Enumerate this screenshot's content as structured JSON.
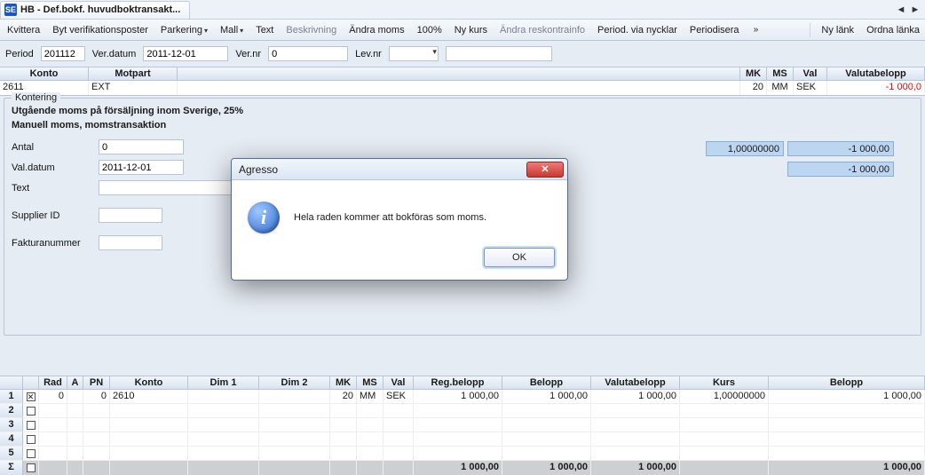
{
  "window": {
    "title": "HB - Def.bokf. huvudboktransakt...",
    "app_icon_text": "SE"
  },
  "toolbar": {
    "items": [
      {
        "label": "Kvittera",
        "disabled": false
      },
      {
        "label": "Byt verifikationsposter",
        "disabled": false
      },
      {
        "label": "Parkering",
        "disabled": false,
        "dropdown": true
      },
      {
        "label": "Mall",
        "disabled": false,
        "dropdown": true
      },
      {
        "label": "Text",
        "disabled": false
      },
      {
        "label": "Beskrivning",
        "disabled": true
      },
      {
        "label": "Ändra moms",
        "disabled": false
      },
      {
        "label": "100%",
        "disabled": false
      },
      {
        "label": "Ny kurs",
        "disabled": false
      },
      {
        "label": "Ändra reskontrainfo",
        "disabled": true
      },
      {
        "label": "Period. via nycklar",
        "disabled": false
      },
      {
        "label": "Periodisera",
        "disabled": false
      }
    ],
    "right": [
      "Ny länk",
      "Ordna länka"
    ]
  },
  "form": {
    "period_label": "Period",
    "period": "201112",
    "verdatum_label": "Ver.datum",
    "verdatum": "2011-12-01",
    "vernr_label": "Ver.nr",
    "vernr": "0",
    "levnr_label": "Lev.nr",
    "levnr": ""
  },
  "upper_grid": {
    "cols": [
      "Konto",
      "Motpart",
      "",
      "MK",
      "MS",
      "Val",
      "Valutabelopp"
    ],
    "row": {
      "konto": "2611",
      "motpart": "EXT",
      "mk": "20",
      "ms": "MM",
      "val": "SEK",
      "valutabelopp": "-1 000,0"
    }
  },
  "kontering": {
    "legend": "Kontering",
    "desc": "Utgående moms på försäljning inom Sverige, 25%",
    "sub": "Manuell moms, momstransaktion",
    "fields": {
      "antal_label": "Antal",
      "antal": "0",
      "valdatum_label": "Val.datum",
      "valdatum": "2011-12-01",
      "text_label": "Text",
      "text": "",
      "supplier_label": "Supplier ID",
      "supplier": "",
      "faktura_label": "Fakturanummer",
      "faktura": ""
    },
    "right": {
      "rate": "1,00000000",
      "amount1": "-1 000,00",
      "amount2": "-1 000,00"
    }
  },
  "data_grid": {
    "cols": [
      "",
      "",
      "Rad",
      "A",
      "PN",
      "Konto",
      "Dim 1",
      "Dim 2",
      "MK",
      "MS",
      "Val",
      "Reg.belopp",
      "Belopp",
      "Valutabelopp",
      "Kurs",
      "Belopp"
    ],
    "rows": [
      {
        "n": "1",
        "chk": true,
        "rad": "0",
        "a": "",
        "pn": "0",
        "konto": "2610",
        "dim1": "",
        "dim2": "",
        "mk": "20",
        "ms": "MM",
        "val": "SEK",
        "reg": "1 000,00",
        "belopp1": "1 000,00",
        "valuta": "1 000,00",
        "kurs": "1,00000000",
        "belopp2": "1 000,00"
      },
      {
        "n": "2",
        "chk": false
      },
      {
        "n": "3",
        "chk": false
      },
      {
        "n": "4",
        "chk": false
      },
      {
        "n": "5",
        "chk": false
      }
    ],
    "sum": {
      "label": "Σ",
      "reg": "1 000,00",
      "belopp1": "1 000,00",
      "valuta": "1 000,00",
      "belopp2": "1 000,00"
    }
  },
  "dialog": {
    "title": "Agresso",
    "message": "Hela raden kommer att bokföras som moms.",
    "ok": "OK"
  }
}
